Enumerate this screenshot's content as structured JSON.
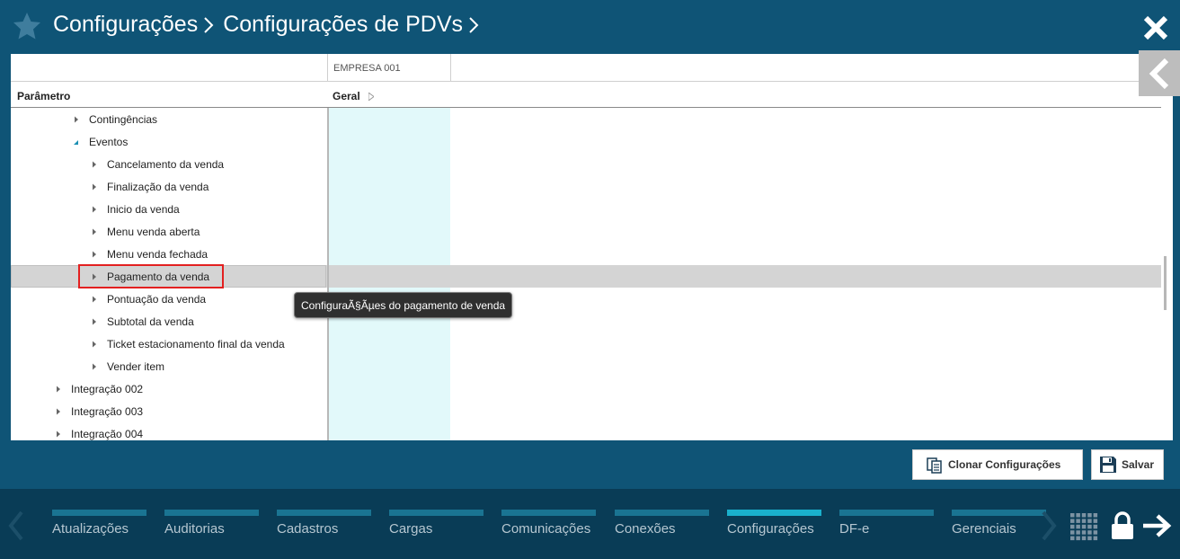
{
  "header": {
    "breadcrumb": [
      "Configurações",
      "Configurações de PDVs"
    ],
    "icons": [
      "star-icon",
      "chevron-right-icon",
      "close-icon"
    ]
  },
  "grid": {
    "column_group": "EMPRESA 001",
    "param_header": "Parâmetro",
    "value_header": "Geral"
  },
  "tree": [
    {
      "label": "Contingências",
      "level": 2,
      "expanded": false
    },
    {
      "label": "Eventos",
      "level": 2,
      "expanded": true
    },
    {
      "label": "Cancelamento da venda",
      "level": 3,
      "expanded": false
    },
    {
      "label": "Finalização da venda",
      "level": 3,
      "expanded": false
    },
    {
      "label": "Inicio da venda",
      "level": 3,
      "expanded": false
    },
    {
      "label": "Menu venda aberta",
      "level": 3,
      "expanded": false
    },
    {
      "label": "Menu venda fechada",
      "level": 3,
      "expanded": false
    },
    {
      "label": "Pagamento da venda",
      "level": 3,
      "expanded": false,
      "selected": true
    },
    {
      "label": "Pontuação da venda",
      "level": 3,
      "expanded": false
    },
    {
      "label": "Subtotal da venda",
      "level": 3,
      "expanded": false
    },
    {
      "label": "Ticket estacionamento final da venda",
      "level": 3,
      "expanded": false
    },
    {
      "label": "Vender item",
      "level": 3,
      "expanded": false
    },
    {
      "label": "Integração 002",
      "level": 1,
      "expanded": false
    },
    {
      "label": "Integração 003",
      "level": 1,
      "expanded": false
    },
    {
      "label": "Integração 004",
      "level": 1,
      "expanded": false
    }
  ],
  "tooltip": "ConfiguraÃ§Ãµes do pagamento de venda",
  "actions": {
    "clone_label": "Clonar Configurações",
    "save_label": "Salvar"
  },
  "bottom_nav": {
    "items": [
      {
        "label": "Atualizações",
        "active": false
      },
      {
        "label": "Auditorias",
        "active": false
      },
      {
        "label": "Cadastros",
        "active": false
      },
      {
        "label": "Cargas",
        "active": false
      },
      {
        "label": "Comunicações",
        "active": false
      },
      {
        "label": "Conexões",
        "active": false
      },
      {
        "label": "Configurações",
        "active": true
      },
      {
        "label": "DF-e",
        "active": false
      },
      {
        "label": "Gerenciais",
        "active": false
      }
    ],
    "icons": [
      "chevron-left-icon",
      "chevron-right-icon",
      "grid-icon",
      "lock-icon",
      "logout-arrow-icon"
    ]
  },
  "colors": {
    "header_bg": "#0f5476",
    "nav_bg": "#093c56",
    "active_tab": "#1ab0cc",
    "tab_bar": "#1a7492",
    "highlight": "#e32020",
    "value_column": "#e2f9fa"
  }
}
